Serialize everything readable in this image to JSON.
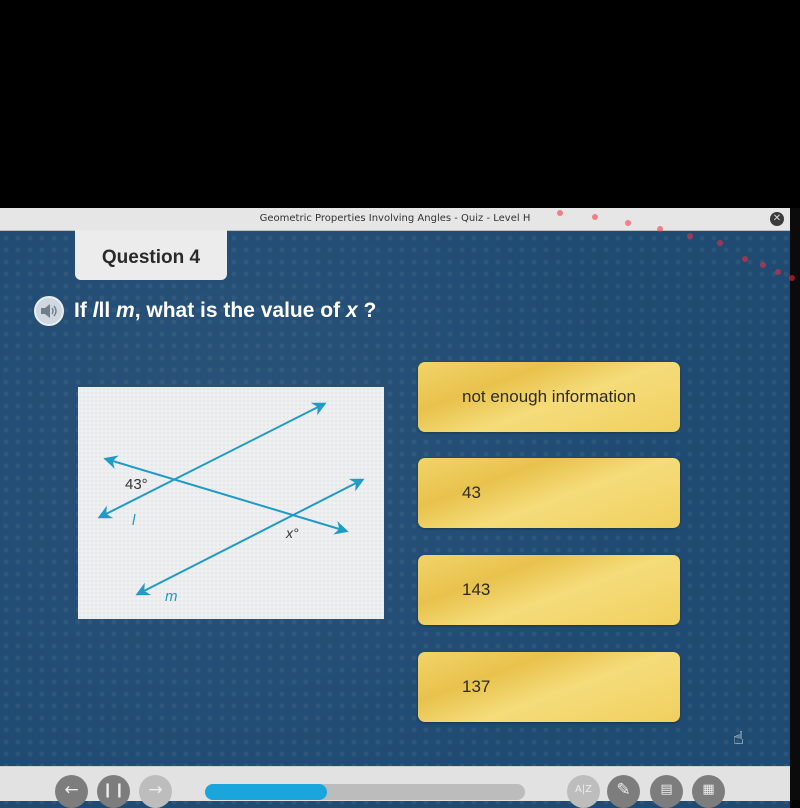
{
  "window": {
    "title": "Geometric Properties Involving Angles - Quiz - Level H",
    "close_icon": "close-x-icon"
  },
  "question": {
    "label": "Question 4",
    "speaker_icon": "speaker-icon",
    "text_prefix": "If ",
    "line1": "l",
    "parallel": "ll",
    "line2": "m",
    "text_middle": ", what is the value of ",
    "variable": "x",
    "text_suffix": " ?"
  },
  "figure": {
    "angle_known": "43°",
    "angle_unknown": "x°",
    "line_label_l": "l",
    "line_label_m": "m",
    "line_color": "#1f9bc6"
  },
  "answers": [
    {
      "label": "not enough information"
    },
    {
      "label": "43"
    },
    {
      "label": "143"
    },
    {
      "label": "137"
    }
  ],
  "toolbar": {
    "back_icon": "arrow-left-icon",
    "pause_icon": "pause-icon",
    "forward_icon": "arrow-right-icon",
    "progress_percent": 38,
    "progress_color": "#1aa6dd",
    "glossary_icon": "glossary-az-icon",
    "pencil_icon": "pencil-icon",
    "notepad_icon": "notepad-icon",
    "calculator_icon": "calculator-icon"
  },
  "colors": {
    "background": "#1f4a72",
    "answer_yellow": "#f0cf5e"
  }
}
